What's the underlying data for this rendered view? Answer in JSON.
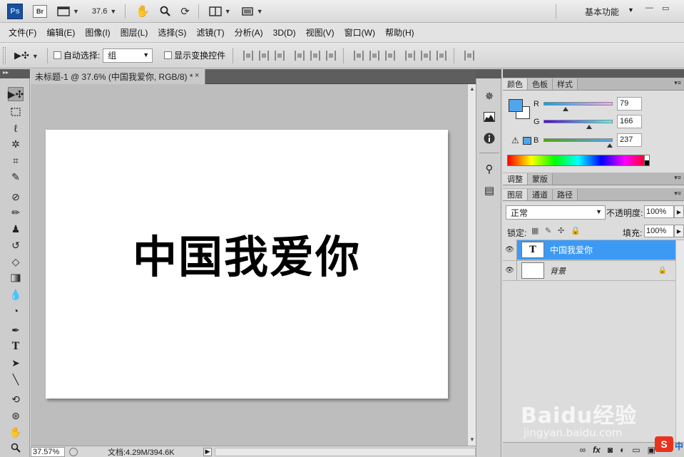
{
  "app": {
    "logo": "Ps",
    "bridge_logo": "Br",
    "zoom": "37.6",
    "workspace": "基本功能",
    "icons": [
      "screen-mode-icon",
      "hand-icon",
      "zoom-icon",
      "rotate-view-icon",
      "arrange-documents-icon",
      "screen-mode-icon"
    ]
  },
  "menu": {
    "items": [
      "文件(F)",
      "编辑(E)",
      "图像(I)",
      "图层(L)",
      "选择(S)",
      "滤镜(T)",
      "分析(A)",
      "3D(D)",
      "视图(V)",
      "窗口(W)",
      "帮助(H)"
    ]
  },
  "options": {
    "auto_select_label": "自动选择:",
    "auto_select_value": "组",
    "show_transform_label": "显示变换控件"
  },
  "document": {
    "tab_title": "未标题-1 @ 37.6% (中国我爱你, RGB/8) *",
    "close": "×",
    "canvas_text": "中国我爱你"
  },
  "status": {
    "zoom": "37.57%",
    "doc_size": "文档:4.29M/394.6K"
  },
  "color_panel": {
    "tabs": [
      "颜色",
      "色板",
      "样式"
    ],
    "channels": [
      {
        "label": "R",
        "value": "79"
      },
      {
        "label": "G",
        "value": "166"
      },
      {
        "label": "B",
        "value": "237"
      }
    ],
    "foreground": "#4fa6ed"
  },
  "adjust_panel": {
    "tabs": [
      "调整",
      "蒙版"
    ]
  },
  "layers_panel": {
    "tabs": [
      "图层",
      "通道",
      "路径"
    ],
    "blend_mode": "正常",
    "opacity_label": "不透明度:",
    "opacity": "100%",
    "lock_label": "锁定:",
    "fill_label": "填充:",
    "fill": "100%",
    "layers": [
      {
        "thumb": "T",
        "name": "中国我爱你"
      },
      {
        "thumb": "",
        "name": "背景"
      }
    ],
    "footer_icons": [
      "link-icon",
      "fx-icon",
      "mask-icon",
      "adjustment-icon",
      "group-icon",
      "new-layer-icon",
      "trash-icon"
    ],
    "fx": "fx"
  },
  "watermark": {
    "text": "Baidu经验",
    "url": "jingyan.baidu.com"
  },
  "ime": {
    "badge": "S",
    "label": "中"
  }
}
